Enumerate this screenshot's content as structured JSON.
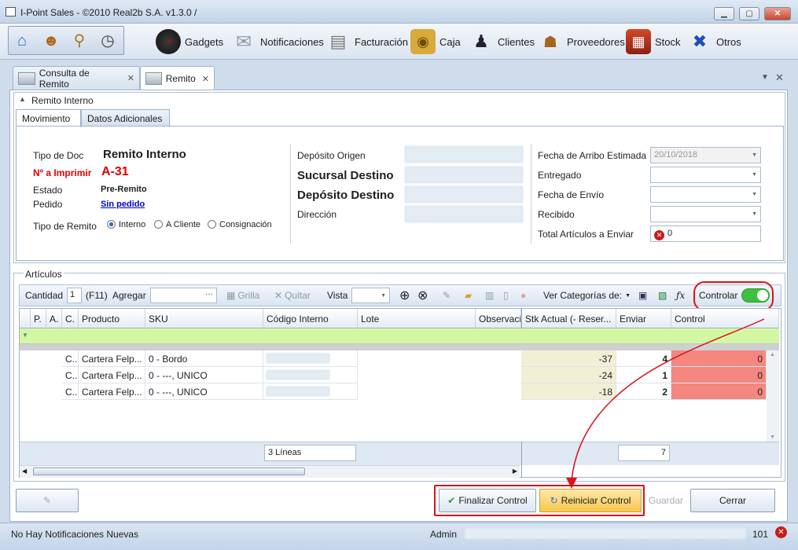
{
  "window": {
    "title": "I-Point Sales  - ©2010 Real2b S.A. v1.3.0 /",
    "min": "▁",
    "max": "▢",
    "close": "✕"
  },
  "menu": [
    {
      "label": "Gadgets",
      "icon": "gauge-icon"
    },
    {
      "label": "Notificaciones",
      "icon": "envelope-icon"
    },
    {
      "label": "Facturación",
      "icon": "cash-register-icon"
    },
    {
      "label": "Caja",
      "icon": "safe-icon"
    },
    {
      "label": "Clientes",
      "icon": "person-icon"
    },
    {
      "label": "Proveedores",
      "icon": "vendor-icon"
    },
    {
      "label": "Stock",
      "icon": "boxes-icon"
    },
    {
      "label": "Otros",
      "icon": "tools-icon"
    }
  ],
  "quick": [
    "home-icon",
    "users-icon",
    "search-icon",
    "clock-icon"
  ],
  "tabs": [
    {
      "label": "Consulta de Remito",
      "close": "✕"
    },
    {
      "label": "Remito",
      "close": "✕"
    }
  ],
  "tabstrip_controls": {
    "menu": "▼",
    "close": "✕"
  },
  "form": {
    "group_title": "Remito Interno",
    "subtabs": [
      "Movimiento",
      "Datos Adicionales"
    ],
    "tipo_doc_label": "Tipo de Doc",
    "tipo_doc_value": "Remito Interno",
    "nro_label": "Nº a Imprimir",
    "nro_value": "A-31",
    "estado_label": "Estado",
    "estado_value": "Pre-Remito",
    "pedido_label": "Pedido",
    "pedido_value": "Sin pedido",
    "tipo_remito_label": "Tipo de Remito",
    "tipo_remito_options": [
      "Interno",
      "A Cliente",
      "Consignación"
    ],
    "tipo_remito_selected": "Interno",
    "deposito_origen_label": "Depósito Origen",
    "sucursal_destino_label": "Sucursal Destino",
    "deposito_destino_label": "Depósito Destino",
    "direccion_label": "Dirección",
    "fecha_arribo_label": "Fecha de Arribo Estimada",
    "fecha_arribo_value": "20/10/2018",
    "entregado_label": "Entregado",
    "entregado_value": "",
    "fecha_envio_label": "Fecha de Envío",
    "fecha_envio_value": "",
    "recibido_label": "Recibido",
    "recibido_value": "",
    "total_label": "Total Artículos a Enviar",
    "total_value": "0"
  },
  "articulos": {
    "title": "Artículos",
    "toolbar": {
      "cantidad_label": "Cantidad",
      "cantidad_value": "1",
      "f11": "(F11)",
      "agregar_label": "Agregar",
      "agregar_value": "",
      "agregar_dots": "···",
      "grilla": "Grilla",
      "quitar": "Quitar",
      "vista_label": "Vista",
      "vista_value": "",
      "ver_categorias": "Ver Categorías de:",
      "controlar": "Controlar",
      "controlar_on": true
    },
    "columns": [
      "P.",
      "A.",
      "C.",
      "Producto",
      "SKU",
      "Código Interno",
      "Lote",
      "Observaci",
      "Stk Actual (- Reser...",
      "Enviar",
      "Control"
    ],
    "rows": [
      {
        "c": "C...",
        "producto": "Cartera Felp...",
        "sku": "0 - Bordo",
        "stk": "-37",
        "enviar": "4",
        "control": "0"
      },
      {
        "c": "C...",
        "producto": "Cartera Felp...",
        "sku": "0 - ---, UNICO",
        "stk": "-24",
        "enviar": "1",
        "control": "0"
      },
      {
        "c": "C...",
        "producto": "Cartera Felp...",
        "sku": "0 - ---, UNICO",
        "stk": "-18",
        "enviar": "2",
        "control": "0"
      }
    ],
    "footer_lines": "3 Líneas",
    "footer_enviar": "7"
  },
  "buttons": {
    "finalizar": "Finalizar Control",
    "reiniciar": "Reiniciar Control",
    "guardar": "Guardar",
    "cerrar": "Cerrar"
  },
  "status": {
    "notifications": "No Hay Notificaciones Nuevas",
    "user": "Admin",
    "count": "101"
  },
  "colors": {
    "control_cell": "#f4877f",
    "stk_cell": "#f1efd6",
    "filter_row": "#d4f7a4",
    "callout": "#d9141b",
    "toggle": "#3fbf3f"
  }
}
